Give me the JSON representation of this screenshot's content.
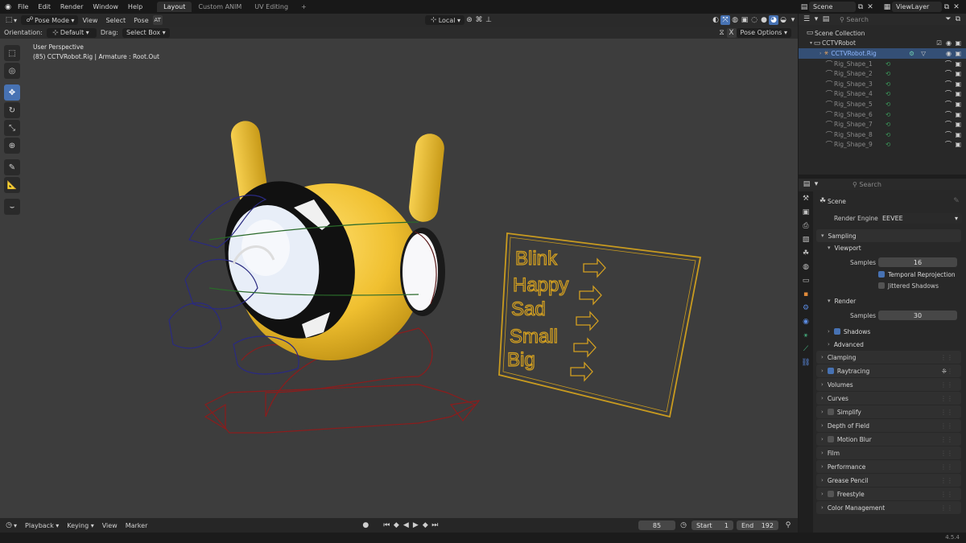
{
  "menu": {
    "items": [
      "File",
      "Edit",
      "Render",
      "Window",
      "Help"
    ],
    "workspaces": [
      "Layout",
      "Custom ANIM",
      "UV Editing"
    ],
    "add_workspace": "+",
    "scene": "Scene",
    "view_layer": "ViewLayer"
  },
  "viewport_header": {
    "mode": "Pose Mode",
    "menus": [
      "View",
      "Select",
      "Pose"
    ],
    "transform_space": "Local",
    "orientation_label": "Orientation:",
    "orientation_value": "Default",
    "drag_label": "Drag:",
    "drag_value": "Select Box",
    "pose_options": "Pose Options",
    "x_mirror": "X"
  },
  "overlay_text": {
    "perspective": "User Perspective",
    "object_info": "(85) CCTVRobot.Rig | Armature : Root.Out"
  },
  "scene_labels": [
    "Blink",
    "Happy",
    "Sad",
    "Small",
    "Big"
  ],
  "timeline": {
    "menus": [
      "Playback",
      "Keying",
      "View",
      "Marker"
    ],
    "current_frame": "85",
    "start_label": "Start",
    "start": "1",
    "end_label": "End",
    "end": "192"
  },
  "status": {
    "version": "4.5.4"
  },
  "outliner": {
    "search_placeholder": "Search",
    "root": "Scene Collection",
    "collection": "CCTVRobot",
    "rig": "CCTVRobot.Rig",
    "shapes": [
      "Rig_Shape_1",
      "Rig_Shape_2",
      "Rig_Shape_3",
      "Rig_Shape_4",
      "Rig_Shape_5",
      "Rig_Shape_6",
      "Rig_Shape_7",
      "Rig_Shape_8",
      "Rig_Shape_9"
    ]
  },
  "properties": {
    "search_placeholder": "Search",
    "context": "Scene",
    "render_engine_label": "Render Engine",
    "render_engine": "EEVEE",
    "sampling": "Sampling",
    "viewport": "Viewport",
    "samples_label": "Samples",
    "viewport_samples": "16",
    "temporal_reprojection": "Temporal Reprojection",
    "jittered_shadows": "Jittered Shadows",
    "render": "Render",
    "render_samples": "30",
    "shadows": "Shadows",
    "advanced": "Advanced",
    "panels": [
      "Clamping",
      "Raytracing",
      "Volumes",
      "Curves",
      "Simplify",
      "Depth of Field",
      "Motion Blur",
      "Film",
      "Performance",
      "Grease Pencil",
      "Freestyle",
      "Color Management"
    ]
  },
  "colors": {
    "accent": "#4772b3",
    "robot": "#f0c030",
    "label_gold": "#d4a020"
  }
}
